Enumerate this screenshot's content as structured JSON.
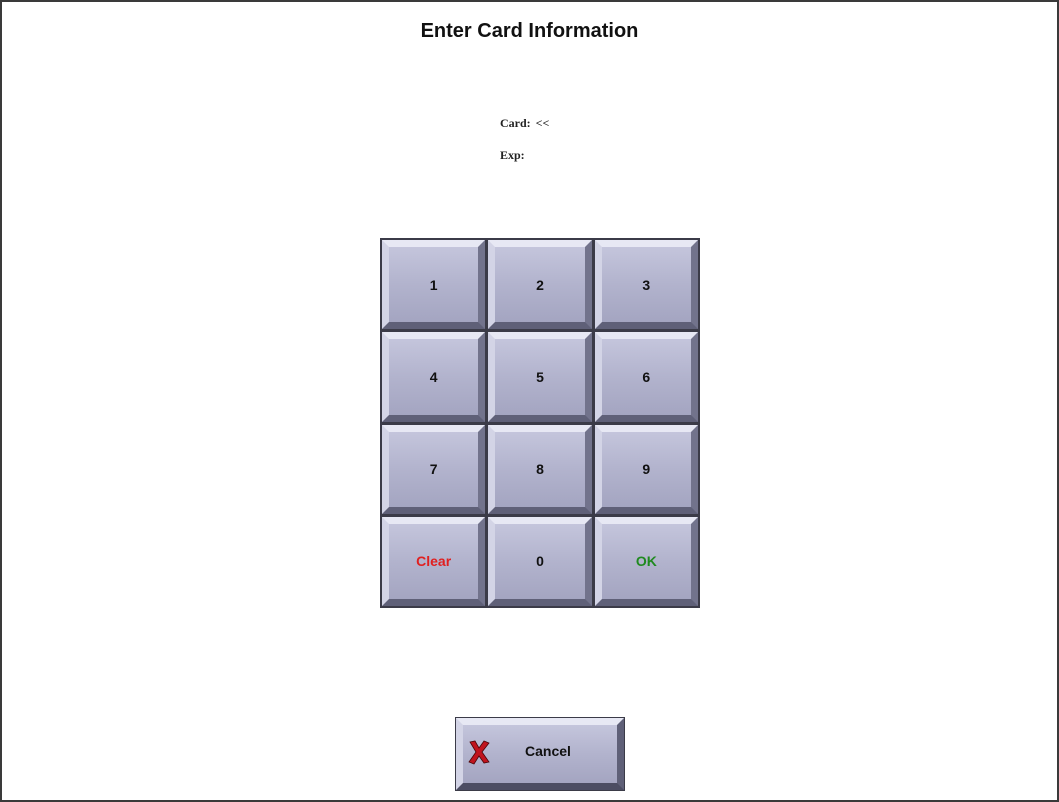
{
  "title": "Enter Card Information",
  "fields": {
    "card_label": "Card:",
    "card_value": "<<",
    "exp_label": "Exp:",
    "exp_value": ""
  },
  "keypad": {
    "keys": [
      "1",
      "2",
      "3",
      "4",
      "5",
      "6",
      "7",
      "8",
      "9",
      "Clear",
      "0",
      "OK"
    ],
    "clear_color": "#e02020",
    "ok_color": "#1f8a1f"
  },
  "cancel_button": {
    "label": "Cancel",
    "icon": "red-x-icon",
    "icon_color": "#c0141e"
  }
}
